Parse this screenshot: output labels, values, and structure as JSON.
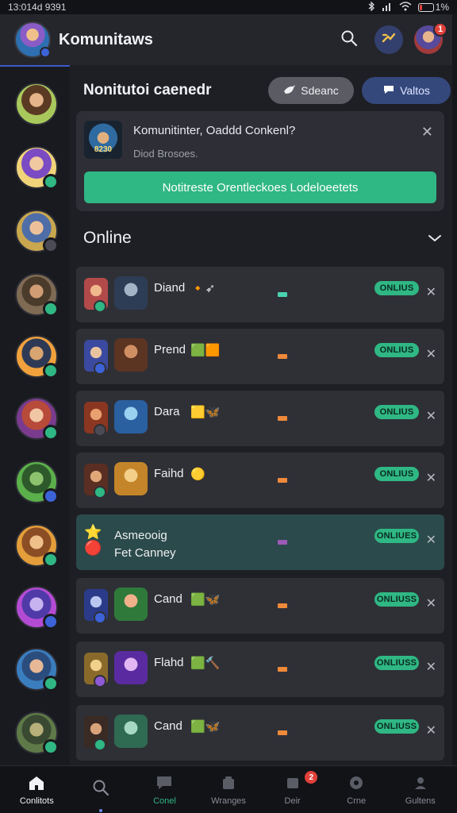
{
  "status_bar": {
    "time": "13:014d 9391",
    "battery": "1%"
  },
  "header": {
    "title": "Komunitaws"
  },
  "header_badges": {
    "notifications": "1"
  },
  "section": {
    "title": "Nonitutoi caenedr",
    "button_left": "Sdeanc",
    "button_right": "Valtos"
  },
  "notice": {
    "title": "Komunitinter, Oaddd Conkenl?",
    "subtitle": "Diod Brosoes.",
    "thumb_text": "8230",
    "cta": "Notitreste Orentleckoes Lodeloeetets"
  },
  "online": {
    "title": "Online"
  },
  "rows": [
    {
      "name": "Diand",
      "emoji": "🔸➶",
      "status": "ONLIUS",
      "mid_color": "#4ad3b0"
    },
    {
      "name": "Prend",
      "emoji": "🟩🟧",
      "status": "ONLIUS",
      "mid_color": "#f08a3a"
    },
    {
      "name": "Dara",
      "emoji": "🟨🦋",
      "status": "ONLIUS",
      "mid_color": "#f08a3a"
    },
    {
      "name": "Faihd",
      "emoji": "🟡",
      "status": "ONLIUS",
      "mid_color": "#f08a3a"
    },
    {
      "name": "Asmeooig",
      "name2": "Fet Canney",
      "status": "ONLIUES",
      "mid_color": "#9c5ab8"
    },
    {
      "name": "Cand",
      "emoji": "🟩🦋",
      "status": "ONLIUSS",
      "mid_color": "#f08a3a"
    },
    {
      "name": "Flahd",
      "emoji": "🟩🔨",
      "status": "ONLIUSS",
      "mid_color": "#f08a3a"
    },
    {
      "name": "Cand",
      "emoji": "🟩🦋",
      "status": "ONLIUSS",
      "mid_color": "#f08a3a"
    }
  ],
  "bottom_nav": [
    {
      "label": "Conlitots"
    },
    {
      "label": ""
    },
    {
      "label": "Conel"
    },
    {
      "label": "Wranges"
    },
    {
      "label": "Deir",
      "badge": "2"
    },
    {
      "label": "Crne"
    },
    {
      "label": "Gultens"
    }
  ],
  "colors": {
    "accent_green": "#2fb784",
    "accent_blue": "#34487c",
    "badge_red": "#e0413a",
    "bg": "#1e1f24"
  }
}
